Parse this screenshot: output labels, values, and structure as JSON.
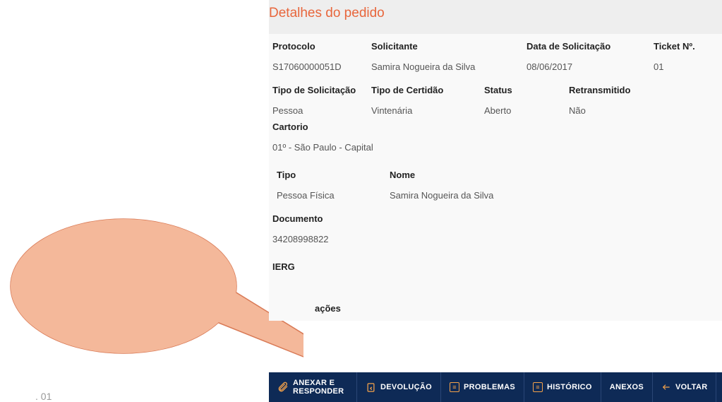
{
  "header": {
    "title": "Detalhes do pedido"
  },
  "fields": {
    "protocolo_label": "Protocolo",
    "protocolo_value": "S17060000051D",
    "solicitante_label": "Solicitante",
    "solicitante_value": "Samira Nogueira da Silva",
    "data_label": "Data de Solicitação",
    "data_value": "08/06/2017",
    "ticket_label": "Ticket Nº.",
    "ticket_value": "01",
    "tipo_solicitacao_label": "Tipo de Solicitação",
    "tipo_solicitacao_value": "Pessoa",
    "tipo_certidao_label": "Tipo de Certidão",
    "tipo_certidao_value": "Vintenária",
    "status_label": "Status",
    "status_value": "Aberto",
    "retransmitido_label": "Retransmitido",
    "retransmitido_value": "Não",
    "cartorio_label": "Cartorio",
    "cartorio_value": "01º - São Paulo - Capital",
    "tipo_label": "Tipo",
    "tipo_value": "Pessoa Física",
    "nome_label": "Nome",
    "nome_value": "Samira Nogueira da Silva",
    "documento_label": "Documento",
    "documento_value": "34208998822",
    "ierg_label": "IERG",
    "observacoes_label": "ações"
  },
  "buttons": {
    "anexar_line1": "ANEXAR E",
    "anexar_line2": "RESPONDER",
    "devolucao": "DEVOLUÇÃO",
    "problemas": "PROBLEMAS",
    "historico": "HISTÓRICO",
    "anexos": "ANEXOS",
    "voltar": "VOLTAR"
  },
  "footer": {
    "note": ". 01"
  }
}
